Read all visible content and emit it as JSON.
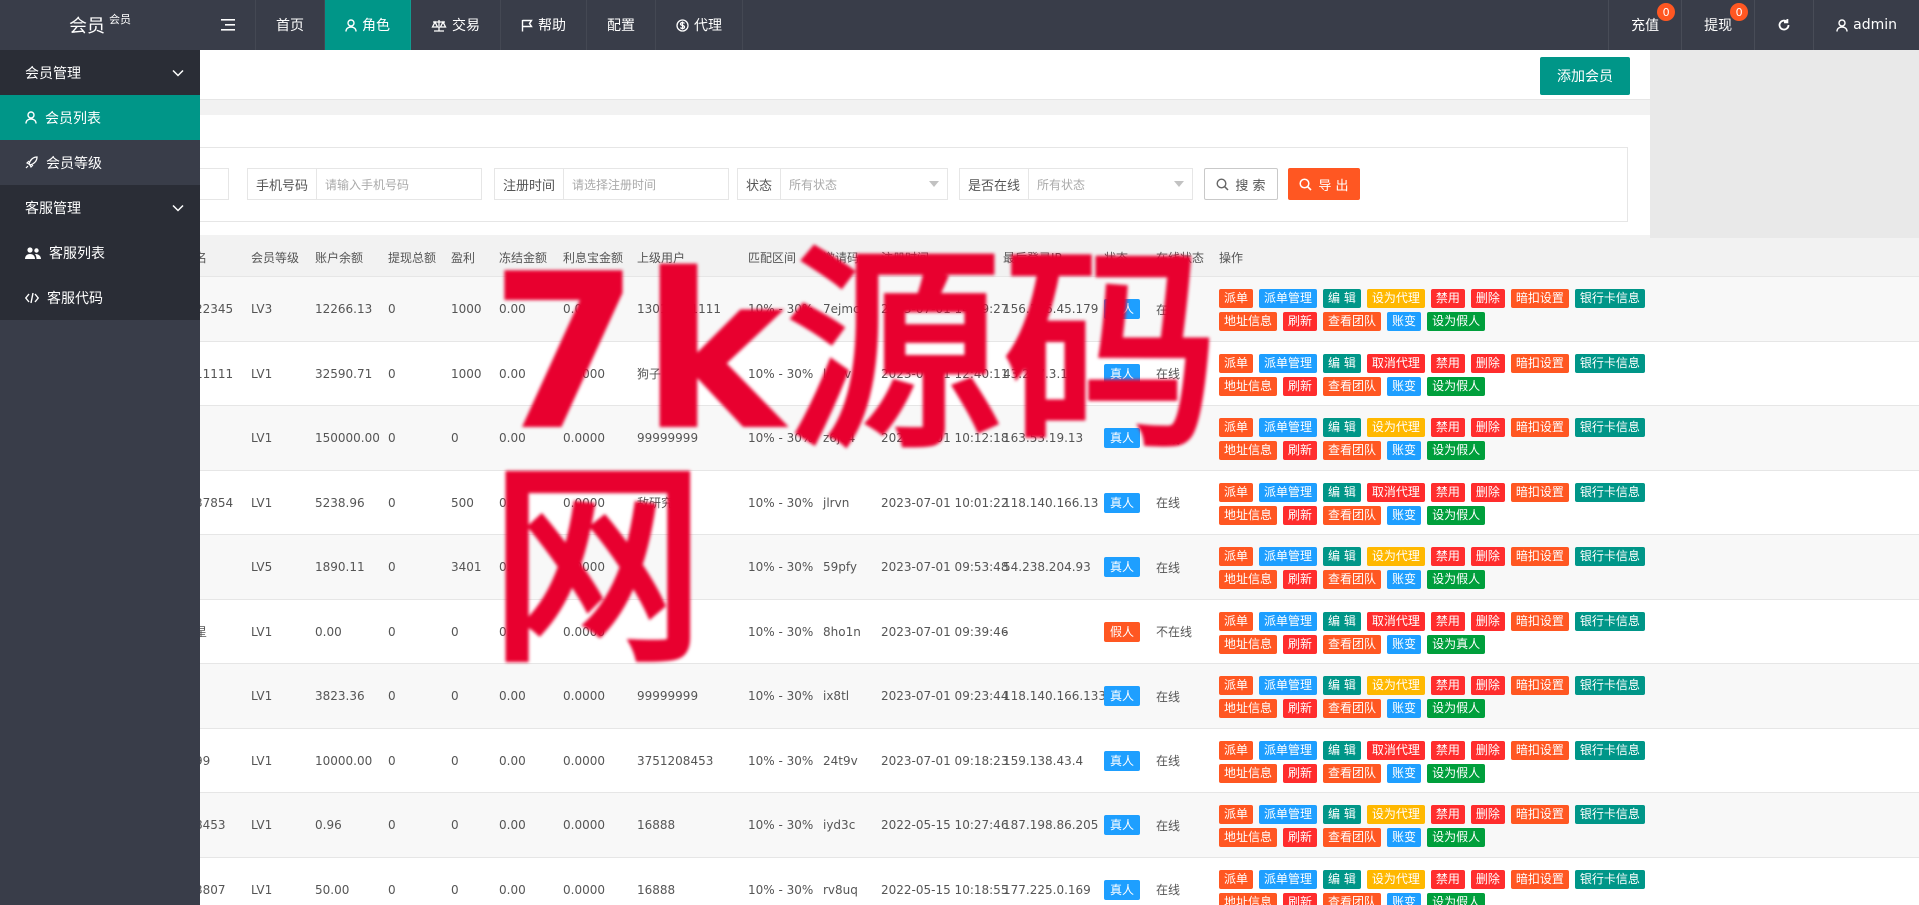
{
  "app": {
    "logo": "会员",
    "logo_sub": "会员"
  },
  "nav": [
    {
      "label": "首页",
      "icon": "",
      "active": false
    },
    {
      "label": "角色",
      "icon": "user-icon",
      "active": true
    },
    {
      "label": "交易",
      "icon": "scale-icon",
      "active": false
    },
    {
      "label": "帮助",
      "icon": "flag-icon",
      "active": false
    },
    {
      "label": "配置",
      "icon": "",
      "active": false
    },
    {
      "label": "代理",
      "icon": "dollar-icon",
      "active": false
    }
  ],
  "topright": {
    "recharge": "充值",
    "recharge_badge": "0",
    "withdraw": "提现",
    "withdraw_badge": "0",
    "user": "admin"
  },
  "sidebar": {
    "group1": "会员管理",
    "item1": "会员列表",
    "item2": "会员等级",
    "group2": "客服管理",
    "item3": "客服列表",
    "item4": "客服代码"
  },
  "toolbar": {
    "add_label": "添加会员"
  },
  "filters": {
    "phone_label": "手机号码",
    "phone_placeholder": "请输入手机号码",
    "regtime_label": "注册时间",
    "regtime_placeholder": "请选择注册时间",
    "status_label": "状态",
    "status_value": "所有状态",
    "online_label": "是否在线",
    "online_value": "所有状态",
    "search_label": "搜 索",
    "export_label": "导 出"
  },
  "table": {
    "headers": {
      "name": "名",
      "level": "会员等级",
      "balance": "账户余额",
      "withdraw": "提现总额",
      "profit": "盈利",
      "frozen": "冻结金额",
      "interest": "利息宝金额",
      "parent": "上级用户",
      "range": "匹配区间",
      "invite": "邀请码",
      "regtime": "注册时间",
      "ip": "最后登录IP",
      "status": "状态",
      "online": "在线状态",
      "ops": "操作"
    },
    "rows": [
      {
        "name": "22345",
        "level": "LV3",
        "balance": "12266.13",
        "withdraw": "0",
        "profit": "1000",
        "frozen": "0.00",
        "interest": "0.0000",
        "parent": "13011111111",
        "range": "10% - 30%",
        "invite": "7ejmc",
        "regtime": "2023-07-01 14:29:27",
        "ip": "156.146.45.179",
        "status": "真人",
        "status_color": "#1e9fff",
        "online": "在线",
        "agent": "设为代理",
        "agent_color": "#ffb800",
        "fake": "设为假人"
      },
      {
        "name": "11111",
        "level": "LV1",
        "balance": "32590.71",
        "withdraw": "0",
        "profit": "1000",
        "frozen": "0.00",
        "interest": "0.0000",
        "parent": "狗子",
        "range": "10% - 30%",
        "invite": "leiyv",
        "regtime": "2023-07-01 12:40:11",
        "ip": "43.207.3.16",
        "status": "真人",
        "status_color": "#1e9fff",
        "online": "在线",
        "agent": "取消代理",
        "agent_color": "#ff2d2d",
        "fake": "设为假人"
      },
      {
        "name": "",
        "level": "LV1",
        "balance": "150000.00",
        "withdraw": "0",
        "profit": "0",
        "frozen": "0.00",
        "interest": "0.0000",
        "parent": "99999999",
        "range": "10% - 30%",
        "invite": "z6jo4",
        "regtime": "2023-07-01 10:12:18",
        "ip": "163.53.19.13",
        "status": "真人",
        "status_color": "#1e9fff",
        "online": "在线",
        "agent": "设为代理",
        "agent_color": "#ffb800",
        "fake": "设为假人"
      },
      {
        "name": "37854",
        "level": "LV1",
        "balance": "5238.96",
        "withdraw": "0",
        "profit": "500",
        "frozen": "0.00",
        "interest": "0.0000",
        "parent": "敌研究",
        "range": "10% - 30%",
        "invite": "jlrvn",
        "regtime": "2023-07-01 10:01:22",
        "ip": "118.140.166.13",
        "status": "真人",
        "status_color": "#1e9fff",
        "online": "在线",
        "agent": "取消代理",
        "agent_color": "#ff2d2d",
        "fake": "设为假人"
      },
      {
        "name": "",
        "level": "LV5",
        "balance": "1890.11",
        "withdraw": "0",
        "profit": "3401",
        "frozen": "0.00",
        "interest": "0.0000",
        "parent": "",
        "range": "10% - 30%",
        "invite": "59pfy",
        "regtime": "2023-07-01 09:53:48",
        "ip": "54.238.204.93",
        "status": "真人",
        "status_color": "#1e9fff",
        "online": "在线",
        "agent": "设为代理",
        "agent_color": "#ffb800",
        "fake": "设为假人"
      },
      {
        "name": "星",
        "level": "LV1",
        "balance": "0.00",
        "withdraw": "0",
        "profit": "0",
        "frozen": "0.00",
        "interest": "0.0000",
        "parent": "",
        "range": "10% - 30%",
        "invite": "8ho1n",
        "regtime": "2023-07-01 09:39:46",
        "ip": "-",
        "status": "假人",
        "status_color": "#ff5722",
        "online": "不在线",
        "agent": "取消代理",
        "agent_color": "#ff2d2d",
        "fake": "设为真人"
      },
      {
        "name": "",
        "level": "LV1",
        "balance": "3823.36",
        "withdraw": "0",
        "profit": "0",
        "frozen": "0.00",
        "interest": "0.0000",
        "parent": "99999999",
        "range": "10% - 30%",
        "invite": "ix8tl",
        "regtime": "2023-07-01 09:23:44",
        "ip": "118.140.166.133",
        "status": "真人",
        "status_color": "#1e9fff",
        "online": "在线",
        "agent": "设为代理",
        "agent_color": "#ffb800",
        "fake": "设为假人"
      },
      {
        "name": "99",
        "level": "LV1",
        "balance": "10000.00",
        "withdraw": "0",
        "profit": "0",
        "frozen": "0.00",
        "interest": "0.0000",
        "parent": "3751208453",
        "range": "10% - 30%",
        "invite": "24t9v",
        "regtime": "2023-07-01 09:18:23",
        "ip": "159.138.43.4",
        "status": "真人",
        "status_color": "#1e9fff",
        "online": "在线",
        "agent": "取消代理",
        "agent_color": "#ff2d2d",
        "fake": "设为假人"
      },
      {
        "name": "8453",
        "level": "LV1",
        "balance": "0.96",
        "withdraw": "0",
        "profit": "0",
        "frozen": "0.00",
        "interest": "0.0000",
        "parent": "16888",
        "range": "10% - 30%",
        "invite": "iyd3c",
        "regtime": "2022-05-15 10:27:46",
        "ip": "187.198.86.205",
        "status": "真人",
        "status_color": "#1e9fff",
        "online": "在线",
        "agent": "设为代理",
        "agent_color": "#ffb800",
        "fake": "设为假人"
      },
      {
        "name": "3807",
        "level": "LV1",
        "balance": "50.00",
        "withdraw": "0",
        "profit": "0",
        "frozen": "0.00",
        "interest": "0.0000",
        "parent": "16888",
        "range": "10% - 30%",
        "invite": "rv8uq",
        "regtime": "2022-05-15 10:18:55",
        "ip": "177.225.0.169",
        "status": "真人",
        "status_color": "#1e9fff",
        "online": "在线",
        "agent": "设为代理",
        "agent_color": "#ffb800",
        "fake": "设为假人"
      }
    ]
  },
  "ops": {
    "dispatch": "派单",
    "dispatch_mgr": "派单管理",
    "edit": "编 辑",
    "ban": "禁用",
    "delete": "删除",
    "deduct": "暗扣设置",
    "bank": "银行卡信息",
    "address": "地址信息",
    "refresh": "刷新",
    "team": "查看团队",
    "ledger": "账变"
  },
  "colors": {
    "primary": "#009688",
    "orange": "#ff5722",
    "blue": "#1e9fff",
    "red": "#ff2d2d",
    "yellow": "#ffb800",
    "green": "#009f3c",
    "dark": "#393d49"
  },
  "watermark": "7k源码网"
}
